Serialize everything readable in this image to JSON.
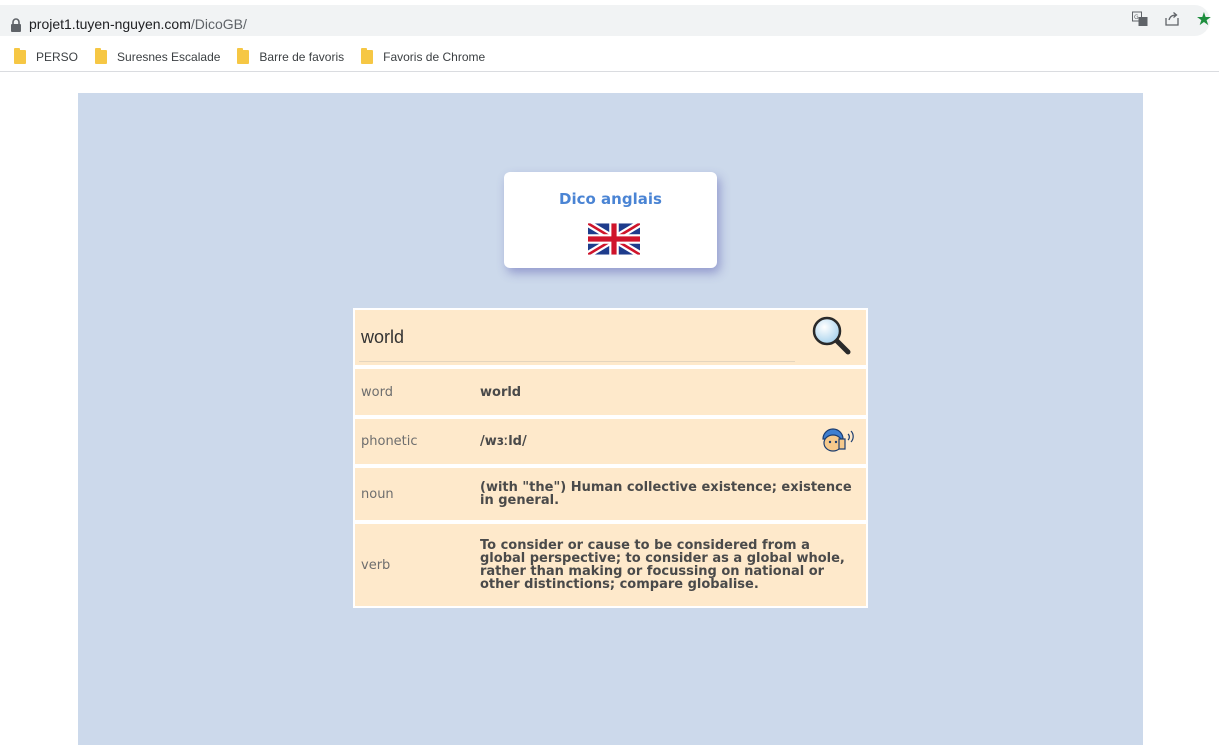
{
  "browser": {
    "url_host": "projet1.tuyen-nguyen.com",
    "url_path": "/DicoGB/",
    "icons": [
      "lock-icon",
      "translate-icon",
      "share-icon",
      "star-icon"
    ],
    "bookmarks": [
      {
        "label": "PERSO",
        "icon": "folder-icon"
      },
      {
        "label": "Suresnes Escalade",
        "icon": "folder-icon"
      },
      {
        "label": "Barre de favoris",
        "icon": "folder-icon"
      },
      {
        "label": "Favoris de Chrome",
        "icon": "folder-icon"
      }
    ]
  },
  "app": {
    "title": "Dico anglais",
    "flag_icon": "uk-flag-icon"
  },
  "search": {
    "value": "world",
    "button_icon": "magnifier-icon"
  },
  "entry": {
    "word_label": "word",
    "word_value": "world",
    "phonetic_label": "phonetic",
    "phonetic_value": "/wɜːld/",
    "speak_icon": "listen-icon",
    "definitions": [
      {
        "pos": "noun",
        "text": "(with \"the\") Human collective existence; existence in general."
      },
      {
        "pos": "verb",
        "text": "To consider or cause to be considered from a global perspective; to consider as a global whole, rather than making or focussing on national or other distinctions; compare globalise."
      }
    ]
  },
  "colors": {
    "page_bg": "#ccd9eb",
    "row_bg": "#fee9cb",
    "title": "#4a84d4",
    "star": "#1e8e3e"
  }
}
